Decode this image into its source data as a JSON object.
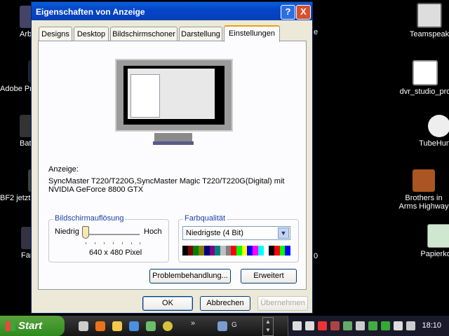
{
  "desktop": {
    "left_icons": [
      {
        "label": "Arb",
        "icon": "app-icon"
      },
      {
        "label": "Adobe Pre",
        "icon": "adobe-premiere-icon"
      },
      {
        "label": "Bat",
        "icon": "app-icon"
      },
      {
        "label": "BF2 jetzt",
        "icon": "game-icon"
      },
      {
        "label": "Far",
        "icon": "app-icon"
      }
    ],
    "right_icons": [
      {
        "label": "Teamspeak",
        "icon": "teamspeak-icon"
      },
      {
        "label": "dvr_studio_pro",
        "icon": "dvr-studio-icon"
      },
      {
        "label": "TubeHunter",
        "icon": "tubehunter-icon"
      },
      {
        "label": "Brothers in Arms Highway",
        "icon": "game-icon"
      },
      {
        "label": "Papierkorb",
        "icon": "recycle-bin-icon"
      }
    ],
    "stray_text": [
      "e",
      "0"
    ]
  },
  "dialog": {
    "title": "Eigenschaften von Anzeige",
    "help_label": "?",
    "close_label": "X",
    "tabs": [
      "Designs",
      "Desktop",
      "Bildschirmschoner",
      "Darstellung",
      "Einstellungen"
    ],
    "active_tab": "Einstellungen",
    "display_label": "Anzeige:",
    "display_line1": "SyncMaster T220/T220G,SyncMaster Magic T220/T220G(Digital) mit",
    "display_line2": "NVIDIA GeForce 8800 GTX",
    "resolution": {
      "legend": "Bildschirmauflösung",
      "low_label": "Niedrig",
      "high_label": "Hoch",
      "value_text": "640 x 480 Pixel",
      "slider_position": 0
    },
    "color_quality": {
      "legend": "Farbqualität",
      "selected": "Niedrigste (4 Bit)"
    },
    "palette_colors": [
      "#000000",
      "#800000",
      "#008000",
      "#808000",
      "#000080",
      "#800080",
      "#008080",
      "#c0c0c0",
      "#808080",
      "#ff0000",
      "#00ff00",
      "#ffff00",
      "#0000ff",
      "#ff00ff",
      "#00ffff",
      "#ffffff",
      "#000000",
      "#ff0000",
      "#00ff00",
      "#0000ff"
    ],
    "troubleshoot_label": "Problembehandlung...",
    "advanced_label": "Erweitert",
    "ok_label": "OK",
    "cancel_label": "Abbrechen",
    "apply_label": "Übernehmen"
  },
  "taskbar": {
    "start_label": "Start",
    "task_label": "G",
    "clock": "18:10"
  },
  "colors": {
    "titlebar": "#0a5fd8",
    "accent_tab": "#e8a10f",
    "legend_text": "#1f3fa8"
  }
}
